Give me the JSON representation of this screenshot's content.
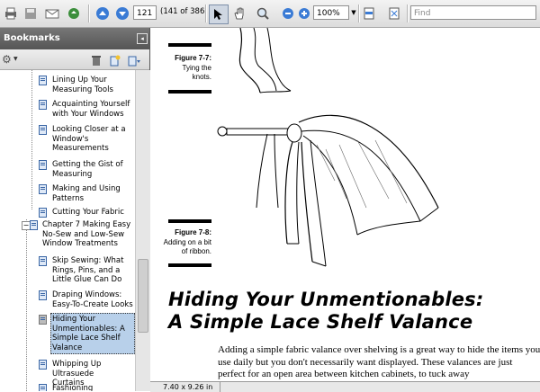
{
  "toolbar": {
    "page_number": "121",
    "page_count": "(141 of 386)",
    "zoom": "100%",
    "find_placeholder": "Find"
  },
  "sidebar": {
    "title": "Bookmarks",
    "items": [
      {
        "label": "Lining Up Your Measuring Tools"
      },
      {
        "label": "Acquainting Yourself with Your Windows"
      },
      {
        "label": "Looking Closer at a Window's Measurements"
      },
      {
        "label": "Getting the Gist of Measuring"
      },
      {
        "label": "Making and Using Patterns"
      },
      {
        "label": "Cutting Your Fabric"
      },
      {
        "label": "Chapter 7 Making Easy No-Sew and Low-Sew Window Treatments"
      },
      {
        "label": "Skip Sewing: What Rings, Pins, and a Little Glue Can Do"
      },
      {
        "label": "Draping Windows: Easy-To-Create Looks"
      },
      {
        "label": "Hiding Your Unmentionables: A Simple Lace Shelf Valance",
        "selected": true
      },
      {
        "label": "Whipping Up Ultrasuede Curtains"
      },
      {
        "label": "Fashioning"
      }
    ]
  },
  "document": {
    "figure7_7_title": "Figure 7-7:",
    "figure7_7_caption": "Tying the knots.",
    "figure7_8_title": "Figure 7-8:",
    "figure7_8_caption": "Adding on a bit of ribbon.",
    "heading_line1": "Hiding Your Unmentionables:",
    "heading_line2": "A Simple Lace Shelf Valance",
    "body_text": "Adding a simple fabric valance over shelving is a great way to hide the items you use daily but you don't necessarily want displayed. These valances are just perfect for an open area between kitchen cabinets, to tuck away"
  },
  "status": {
    "page_size": "7.40 x 9.26 in"
  }
}
